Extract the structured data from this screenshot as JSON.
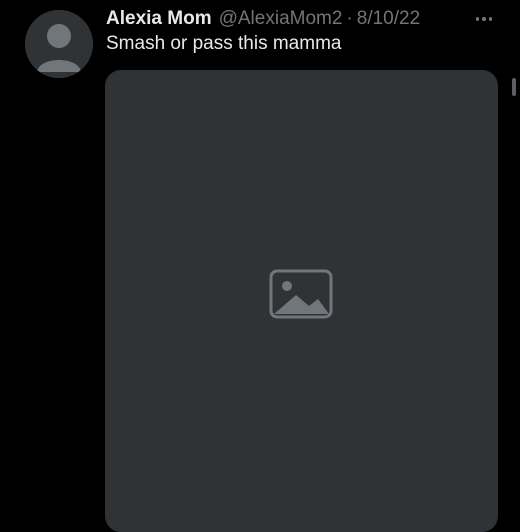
{
  "tweet": {
    "author_name": "Alexia Mom",
    "handle": "@AlexiaMom2",
    "separator": "·",
    "date": "8/10/22",
    "text": "Smash or pass this mamma",
    "avatar_icon": "user-avatar-icon",
    "more_icon": "more-options-icon",
    "media_icon": "image-placeholder-icon"
  },
  "colors": {
    "background": "#000000",
    "primary_text": "#e7e9ea",
    "secondary_text": "#71767b",
    "placeholder": "#2f3336"
  }
}
